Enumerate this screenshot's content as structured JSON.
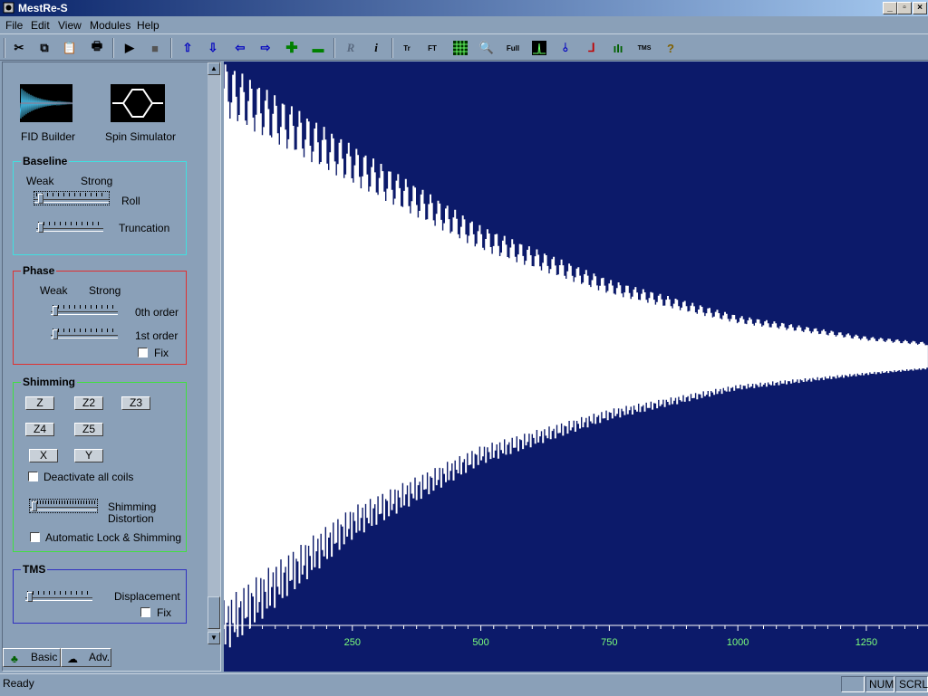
{
  "window": {
    "title": "MestRe-S"
  },
  "menu": [
    "File",
    "Edit",
    "View",
    "Modules",
    "Help"
  ],
  "toolbar": {
    "buttons": [
      "cut-icon",
      "copy-icon",
      "paste-icon",
      "print-icon",
      "play-icon",
      "stop-icon",
      "arrow-up-icon",
      "arrow-down-icon",
      "arrow-left-icon",
      "arrow-right-icon",
      "zoom-in-plus-icon",
      "zoom-out-minus-icon",
      "r-icon",
      "info-icon",
      "tr-icon",
      "ft-icon",
      "grid-icon",
      "magnifier-icon",
      "full-icon",
      "peak-icon",
      "integral-icon",
      "baseline-icon",
      "multiplet-icon",
      "tms-icon",
      "help-icon"
    ],
    "r_label": "R",
    "info_label": "i",
    "tr_label": "Tr",
    "ft_label": "FT",
    "full_label": "Full",
    "tms_label": "TMS",
    "help_label": "?"
  },
  "panel": {
    "fid_builder": "FID Builder",
    "spin_simulator": "Spin Simulator",
    "baseline": {
      "title": "Baseline",
      "weak": "Weak",
      "strong": "Strong",
      "roll": "Roll",
      "truncation": "Truncation"
    },
    "phase": {
      "title": "Phase",
      "weak": "Weak",
      "strong": "Strong",
      "zero_order": "0th order",
      "first_order": "1st order",
      "fix": "Fix"
    },
    "shimming": {
      "title": "Shimming",
      "buttons": [
        "Z",
        "Z2",
        "Z3",
        "Z4",
        "Z5",
        "X",
        "Y"
      ],
      "deactivate": "Deactivate all coils",
      "distortion_line1": "Shimming",
      "distortion_line2": "Distortion",
      "auto_lock": "Automatic Lock & Shimming"
    },
    "tms": {
      "title": "TMS",
      "displacement": "Displacement",
      "fix": "Fix"
    },
    "tabs": [
      "Basic",
      "Adv."
    ]
  },
  "colors": {
    "plot_bg": "#0c1a6a",
    "signal": "#ffffff",
    "axis_labels": "#7cff7c"
  },
  "chart_data": {
    "type": "line",
    "description_source": "FID signal display",
    "x_ticks": [
      250,
      500,
      750,
      1000,
      1250
    ],
    "xlim": [
      0,
      1370
    ],
    "envelope_upper_top": [
      [
        0,
        1.0
      ],
      [
        250,
        0.72
      ],
      [
        500,
        0.45
      ],
      [
        750,
        0.27
      ],
      [
        1000,
        0.15
      ],
      [
        1250,
        0.08
      ],
      [
        1370,
        0.06
      ]
    ],
    "envelope_lower_bottom": [
      [
        0,
        -0.98
      ],
      [
        250,
        -0.6
      ],
      [
        500,
        -0.35
      ],
      [
        750,
        -0.2
      ],
      [
        1000,
        -0.1
      ],
      [
        1250,
        -0.05
      ],
      [
        1370,
        -0.03
      ]
    ]
  },
  "status": {
    "text": "Ready",
    "num": "NUM",
    "scrl": "SCRL"
  }
}
